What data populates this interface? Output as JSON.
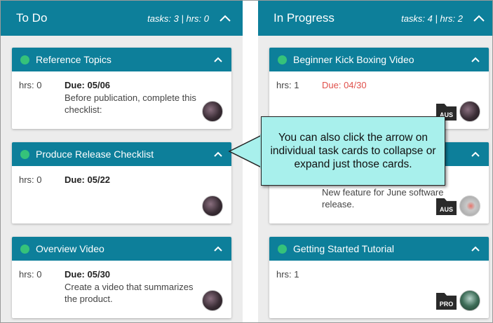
{
  "columns": [
    {
      "title": "To Do",
      "stats": "tasks: 3 | hrs: 0",
      "cards": [
        {
          "title": "Reference Topics",
          "hrs": "hrs: 0",
          "due": "Due: 05/06",
          "desc": "Before publication, complete this checklist:",
          "avatar": "avatar-dark"
        },
        {
          "title": "Produce Release Checklist",
          "hrs": "hrs: 0",
          "due": "Due: 05/22",
          "desc": "",
          "avatar": "avatar-dark"
        },
        {
          "title": "Overview Video",
          "hrs": "hrs: 0",
          "due": "Due: 05/30",
          "desc": "Create a video that summarizes the product.",
          "avatar": "avatar-dark"
        }
      ]
    },
    {
      "title": "In Progress",
      "stats": "tasks: 4 | hrs: 2",
      "cards": [
        {
          "title": "Beginner Kick Boxing Video",
          "hrs": "hrs: 1",
          "due": "Due: 04/30",
          "desc": "",
          "badge": "AUS",
          "avatar": "avatar-dark"
        },
        {
          "title": "",
          "hrs": "",
          "due": "",
          "desc": "New feature for June software release.",
          "badge": "AUS",
          "avatar": "avatar-gray"
        },
        {
          "title": "Getting Started Tutorial",
          "hrs": "hrs: 1",
          "due": "",
          "desc": "",
          "badge": "PRO",
          "avatar": "avatar-forest"
        }
      ]
    }
  ],
  "callout": {
    "text": "You can also click the arrow on individual task cards to collapse or expand just those cards."
  },
  "colors": {
    "header": "#0d7f9a",
    "status_dot": "#35c27a",
    "overdue": "#e0504b",
    "callout_bg": "#a8f0ec"
  }
}
